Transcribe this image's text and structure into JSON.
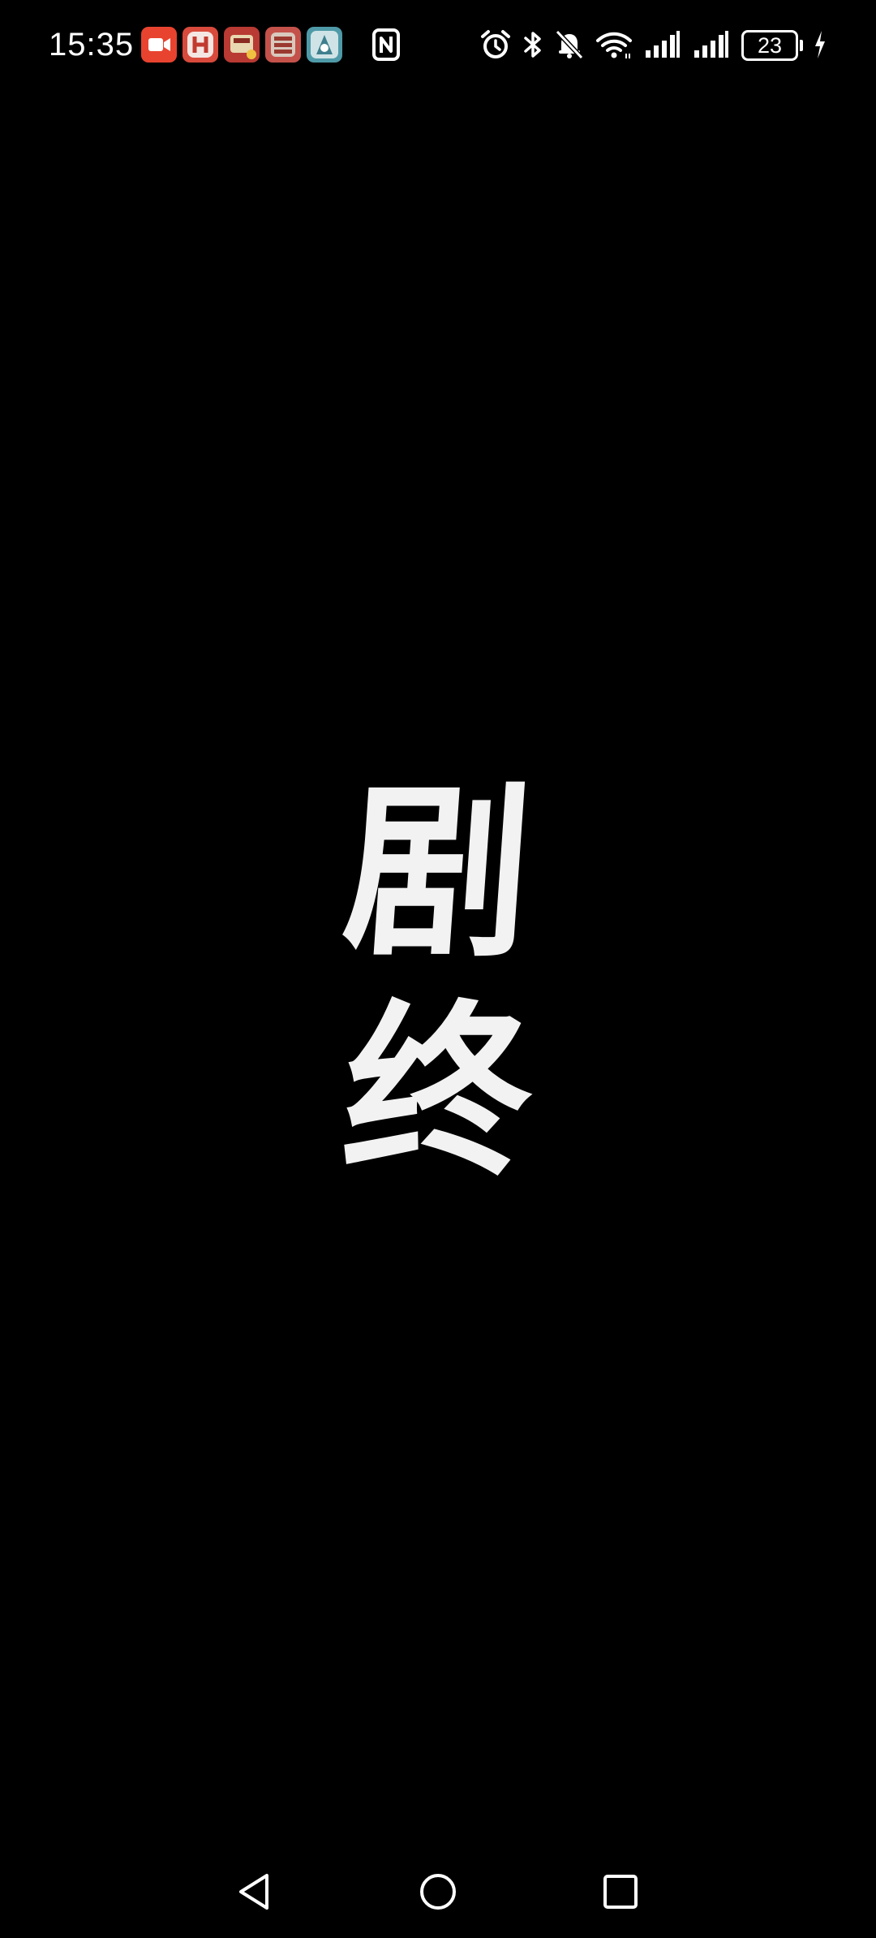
{
  "status_bar": {
    "time": "15:35",
    "battery_level": "23",
    "notification_icons": [
      "screen-recorder-icon",
      "app-notification-icon-1",
      "app-notification-icon-2",
      "app-notification-icon-3",
      "app-notification-icon-4"
    ],
    "system_icons": [
      "nfc-icon",
      "alarm-icon",
      "bluetooth-icon",
      "mute-bell-icon",
      "wifi-icon",
      "signal-icon-sim1",
      "signal-icon-sim2",
      "battery-icon",
      "charging-bolt-icon"
    ]
  },
  "main": {
    "end_title_line1": "剧",
    "end_title_line2": "终"
  },
  "nav_bar": {
    "buttons": [
      "back-icon",
      "home-icon",
      "recents-icon"
    ]
  },
  "colors": {
    "background": "#000000",
    "foreground": "#ffffff",
    "recorder_red": "#e8432f",
    "app_icon_red": "#c9403a",
    "app_icon_teal": "#4f9aa8"
  }
}
